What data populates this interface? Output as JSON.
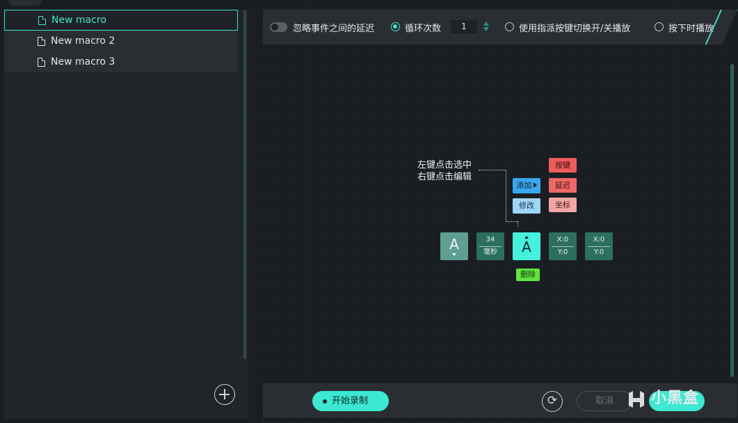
{
  "macros": [
    {
      "name": "New macro",
      "active": true
    },
    {
      "name": "New macro 2",
      "active": false
    },
    {
      "name": "New macro 3",
      "active": false
    }
  ],
  "options": {
    "ignore_delay_label": "忽略事件之间的延迟",
    "loop_count_label": "循环次数",
    "loop_count_value": "1",
    "toggle_key_label": "使用指派按键切换开/关播放",
    "hold_play_label": "按下时播放"
  },
  "help": {
    "line1": "左键点击选中",
    "line2": "右键点击编辑"
  },
  "actions": {
    "add": "添加",
    "edit": "修改",
    "key": "按键",
    "delay": "延迟",
    "coord": "坐标",
    "delete": "删除"
  },
  "timeline": {
    "key1": "A",
    "delay_value": "34",
    "delay_unit": "毫秒",
    "key2": "A",
    "pos1_x": "X:0",
    "pos1_y": "Y:0",
    "pos2_x": "X:0",
    "pos2_y": "Y:0"
  },
  "bottom": {
    "record": "开始录制",
    "cancel": "取消"
  },
  "watermark": "小黑盒",
  "colors": {
    "accent": "#3fe3cf",
    "background": "#191c20",
    "panel": "#212428"
  }
}
